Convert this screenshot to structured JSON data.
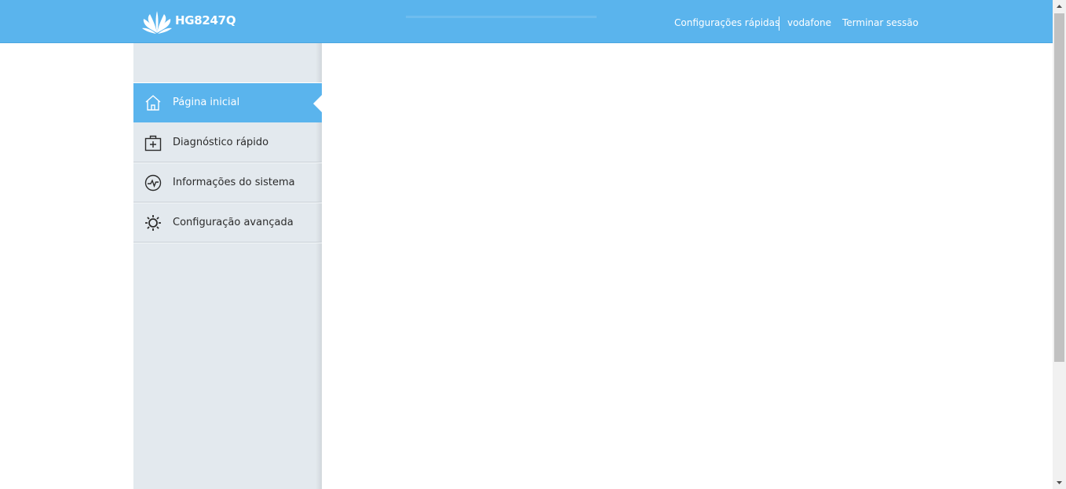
{
  "header": {
    "model": "HG8247Q",
    "links": {
      "quick_config": "Configurações rápidas",
      "user": "vodafone",
      "logout": "Terminar sessão"
    }
  },
  "sidebar": {
    "items": [
      {
        "label": "Página inicial",
        "icon": "home-icon",
        "active": true
      },
      {
        "label": "Diagnóstico rápido",
        "icon": "first-aid-kit-icon",
        "active": false
      },
      {
        "label": "Informações do sistema",
        "icon": "heartbeat-icon",
        "active": false
      },
      {
        "label": "Configuração avançada",
        "icon": "gear-icon",
        "active": false
      }
    ]
  },
  "colors": {
    "accent": "#5ab4ed",
    "sidebar_bg": "#e3e9ee",
    "text": "#2b2b2b"
  }
}
